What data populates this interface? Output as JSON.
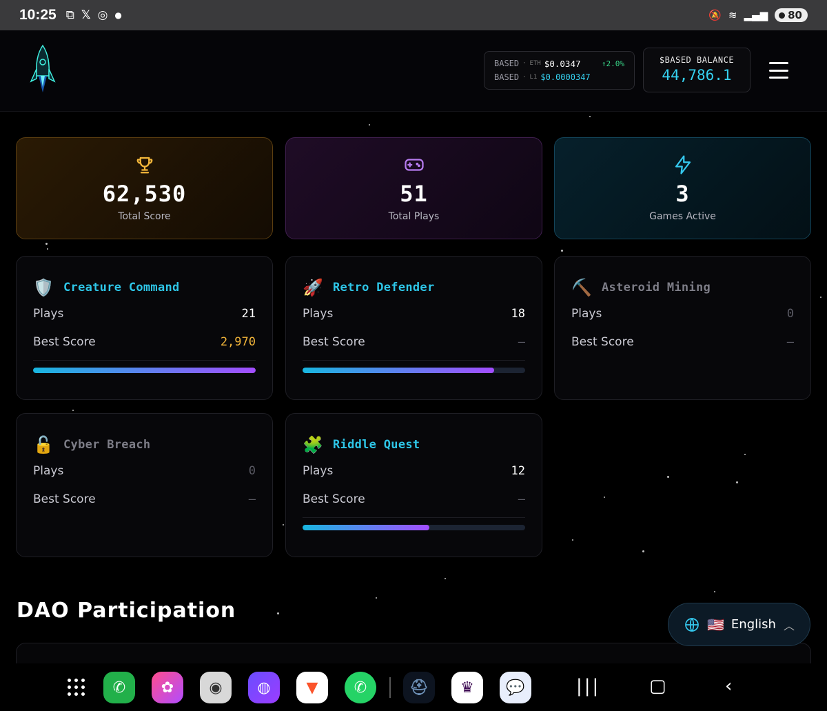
{
  "status_bar": {
    "time": "10:25",
    "battery": "80"
  },
  "header": {
    "price": {
      "row1": {
        "token": "BASED",
        "pair": "ETH",
        "value": "$0.0347",
        "change": "↑2.0%"
      },
      "row2": {
        "token": "BASED",
        "pair": "L1",
        "value": "$0.0000347"
      }
    },
    "balance": {
      "label": "$BASED BALANCE",
      "amount": "44,786.1"
    }
  },
  "stats": [
    {
      "value": "62,530",
      "label": "Total Score",
      "icon": "trophy-icon",
      "color": "#f3b63a"
    },
    {
      "value": "51",
      "label": "Total Plays",
      "icon": "gamepad-icon",
      "color": "#b77cf0"
    },
    {
      "value": "3",
      "label": "Games Active",
      "icon": "lightning-icon",
      "color": "#35c9ef"
    }
  ],
  "games": [
    {
      "emoji": "🛡️",
      "name": "Creature Command",
      "plays_label": "Plays",
      "plays": "21",
      "best_label": "Best Score",
      "best": "2,970",
      "progress": 1.0
    },
    {
      "emoji": "🚀",
      "name": "Retro Defender",
      "plays_label": "Plays",
      "plays": "18",
      "best_label": "Best Score",
      "best": "—",
      "progress": 0.86
    },
    {
      "emoji": "⛏️",
      "name": "Asteroid Mining",
      "plays_label": "Plays",
      "plays": "0",
      "best_label": "Best Score",
      "best": "—"
    },
    {
      "emoji": "🔓",
      "name": "Cyber Breach",
      "plays_label": "Plays",
      "plays": "0",
      "best_label": "Best Score",
      "best": "—"
    },
    {
      "emoji": "🧩",
      "name": "Riddle Quest",
      "plays_label": "Plays",
      "plays": "12",
      "best_label": "Best Score",
      "best": "—",
      "progress": 0.57
    }
  ],
  "dao": {
    "title": "DAO Participation"
  },
  "language": {
    "flag": "🇺🇸",
    "label": "English"
  },
  "colors": {
    "accent_cyan": "#2ec6e8",
    "gold": "#f3b63a",
    "bar_start": "#18b6e0",
    "bar_end": "#a34dff"
  }
}
